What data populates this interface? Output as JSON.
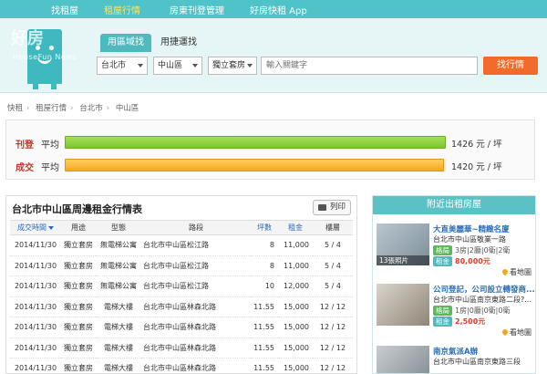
{
  "topnav": {
    "items": [
      {
        "label": "找租屋",
        "active": false
      },
      {
        "label": "租屋行情",
        "active": true
      },
      {
        "label": "房東刊登管理",
        "active": false
      },
      {
        "label": "好房快租 App",
        "active": false
      }
    ]
  },
  "logo": {
    "text": "好房",
    "sub": "HouseFun News"
  },
  "search": {
    "tabs": [
      {
        "label": "用區域找"
      },
      {
        "label": "用捷運找"
      }
    ],
    "city": "台北市",
    "district": "中山區",
    "type": "獨立套房",
    "keyword_placeholder": "輸入關鍵字",
    "button": "找行情"
  },
  "breadcrumb": [
    "快租",
    "租屋行情",
    "台北市",
    "中山區"
  ],
  "summary": {
    "rows": [
      {
        "label": "刊登",
        "avg": "平均",
        "value": "1426",
        "unit": "元 / 坪",
        "fill": 1.0,
        "color": "green"
      },
      {
        "label": "成交",
        "avg": "平均",
        "value": "1420",
        "unit": "元 / 坪",
        "fill": 0.996,
        "color": "orange"
      }
    ]
  },
  "table": {
    "title": "台北市中山區周邊租金行情表",
    "print": "列印",
    "headers": [
      "成交時間",
      "用途",
      "型態",
      "路段",
      "坪數",
      "租金",
      "樓層"
    ],
    "rows": [
      [
        "2014/11/30",
        "獨立套房",
        "無電梯公寓",
        "台北市中山區松江路",
        "8",
        "11,000",
        "5 / 4"
      ],
      [
        "2014/11/30",
        "獨立套房",
        "無電梯公寓",
        "台北市中山區松江路",
        "8",
        "11,000",
        "5 / 4"
      ],
      [
        "2014/11/30",
        "獨立套房",
        "無電梯公寓",
        "台北市中山區松江路",
        "10",
        "12,000",
        "5 / 4"
      ],
      [
        "2014/11/30",
        "獨立套房",
        "電梯大樓",
        "台北市中山區林森北路",
        "11.55",
        "15,000",
        "12 / 12"
      ],
      [
        "2014/11/30",
        "獨立套房",
        "電梯大樓",
        "台北市中山區林森北路",
        "11.55",
        "15,000",
        "12 / 12"
      ],
      [
        "2014/11/30",
        "獨立套房",
        "電梯大樓",
        "台北市中山區林森北路",
        "11.55",
        "15,000",
        "12 / 12"
      ],
      [
        "2014/11/30",
        "獨立套房",
        "電梯大樓",
        "台北市中山區林森北路",
        "11.55",
        "15,000",
        "12 / 12"
      ]
    ]
  },
  "side": {
    "title": "附近出租房屋",
    "listings": [
      {
        "title": "大直美麗華~精緻名廈",
        "addr": "台北市中山區敬業一路",
        "badge": "格局",
        "info": "3房|2廳|0衛|2衛",
        "rent_badge": "租金",
        "price": "80,000元",
        "tag": "13張照片",
        "map": "看地圖"
      },
      {
        "title": "公司登記，公司設立轉發商...",
        "addr": "台北市中山區南京東路二段?...",
        "badge": "格局",
        "info": "1房|0廳|0衛|0衛",
        "rent_badge": "租金",
        "price": "2,500元",
        "tag": "",
        "map": "看地圖"
      },
      {
        "title": "南京氣派A辦",
        "addr": "台北市中山區南京東路三段",
        "badge": "",
        "info": "",
        "rent_badge": "",
        "price": "",
        "tag": "",
        "map": ""
      }
    ]
  },
  "colors": {
    "nav": "#4fc3c8",
    "accent_button": "#f26b2a",
    "green_bar": "#7cc52e",
    "orange_bar": "#f5a623"
  }
}
